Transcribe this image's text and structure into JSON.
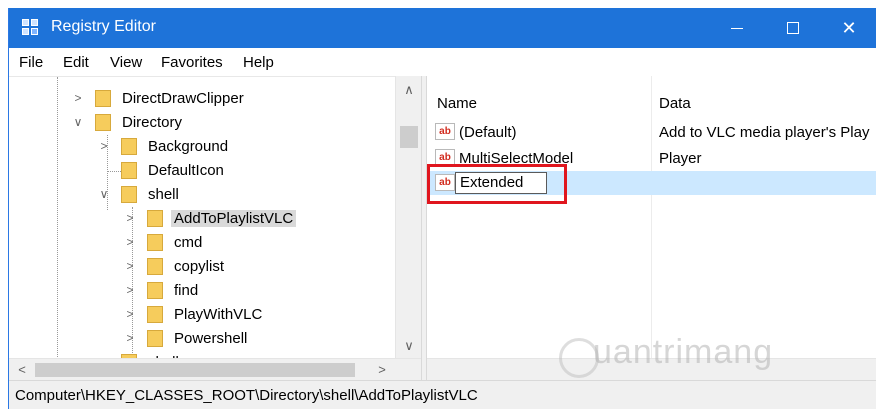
{
  "window": {
    "title": "Registry Editor",
    "icon": "registry-editor-icon",
    "controls": [
      "minimize-icon",
      "maximize-icon",
      "close-icon"
    ]
  },
  "menu": {
    "file": "File",
    "edit": "Edit",
    "view": "View",
    "favorites": "Favorites",
    "help": "Help"
  },
  "tree": {
    "items": [
      {
        "label": "DirectDrawClipper",
        "expander": "collapsed"
      },
      {
        "label": "Directory",
        "expander": "expanded"
      },
      {
        "label": "Background",
        "expander": "collapsed"
      },
      {
        "label": "DefaultIcon",
        "expander": "none"
      },
      {
        "label": "shell",
        "expander": "expanded"
      },
      {
        "label": "AddToPlaylistVLC",
        "expander": "collapsed",
        "selected": true
      },
      {
        "label": "cmd",
        "expander": "collapsed"
      },
      {
        "label": "copylist",
        "expander": "collapsed"
      },
      {
        "label": "find",
        "expander": "collapsed"
      },
      {
        "label": "PlayWithVLC",
        "expander": "collapsed"
      },
      {
        "label": "Powershell",
        "expander": "collapsed"
      },
      {
        "label": "shellex",
        "expander": "collapsed"
      }
    ]
  },
  "list": {
    "columns": {
      "name": "Name",
      "data": "Data"
    },
    "rows": [
      {
        "name": "(Default)",
        "data": "Add to VLC media player's Play",
        "icon": "string-value-icon"
      },
      {
        "name": "MultiSelectModel",
        "data": "Player",
        "icon": "string-value-icon"
      },
      {
        "name": "",
        "data": "",
        "icon": "string-value-icon",
        "selected": true,
        "editing": true
      }
    ],
    "rename_value": "Extended"
  },
  "status": {
    "path": "Computer\\HKEY_CLASSES_ROOT\\Directory\\shell\\AddToPlaylistVLC"
  },
  "watermark": {
    "text": "uantrimang"
  },
  "colors": {
    "titlebar": "#1e73d9",
    "selection": "#cce8ff",
    "highlight_frame": "#e0161e"
  }
}
